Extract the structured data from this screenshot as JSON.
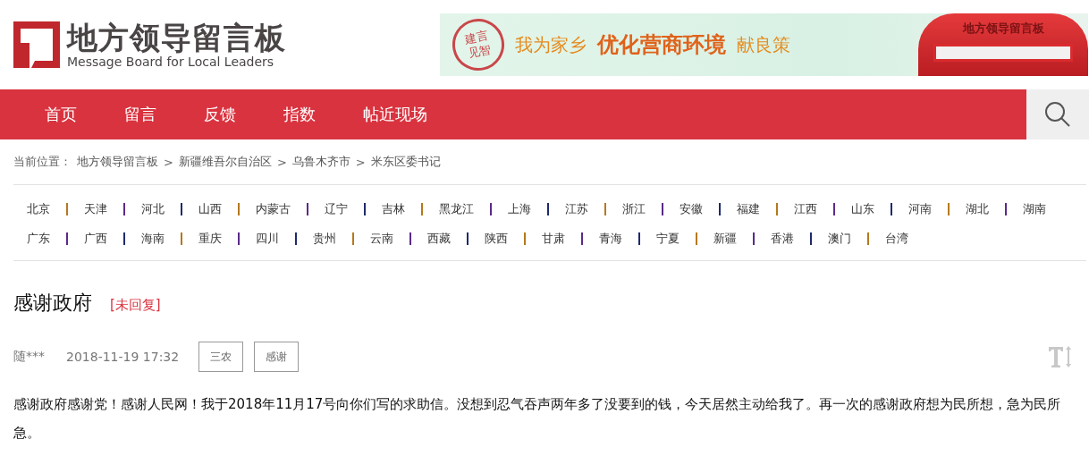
{
  "logo": {
    "title": "地方领导留言板",
    "subtitle": "Message Board for Local Leaders"
  },
  "banner": {
    "stamp": "建言见智",
    "slogan_start": "我为家乡",
    "slogan_main": "优化营商环境",
    "slogan_end": "献良策",
    "mailbox_label": "地方领导留言板"
  },
  "nav": {
    "items": [
      {
        "label": "首页",
        "selected": false
      },
      {
        "label": "留言",
        "selected": false
      },
      {
        "label": "反馈",
        "selected": false
      },
      {
        "label": "指数",
        "selected": false
      },
      {
        "label": "帖近现场",
        "selected": false
      }
    ]
  },
  "breadcrumb": {
    "label": "当前位置：",
    "items": [
      "地方领导留言板",
      "新疆维吾尔自治区",
      "乌鲁木齐市",
      "米东区委书记"
    ],
    "separator": ">"
  },
  "province_rows": [
    [
      "北京",
      "天津",
      "河北",
      "山西",
      "内蒙古",
      "辽宁",
      "吉林",
      "黑龙江",
      "上海",
      "江苏",
      "浙江",
      "安徽",
      "福建",
      "江西",
      "山东",
      "河南",
      "湖北",
      "湖南"
    ],
    [
      "广东",
      "广西",
      "海南",
      "重庆",
      "四川",
      "贵州",
      "云南",
      "西藏",
      "陕西",
      "甘肃",
      "青海",
      "宁夏",
      "新疆",
      "香港",
      "澳门",
      "台湾"
    ]
  ],
  "message": {
    "title": "感谢政府",
    "status": "[未回复]",
    "author": "随***",
    "time": "2018-11-19 17:32",
    "tags": [
      "三农",
      "感谢"
    ],
    "body": "感谢政府感谢党！感谢人民网！我于2018年11月17号向你们写的求助信。没想到忍气吞声两年多了没要到的钱，今天居然主动给我了。再一次的感谢政府想为民所想，急为民所急。"
  }
}
